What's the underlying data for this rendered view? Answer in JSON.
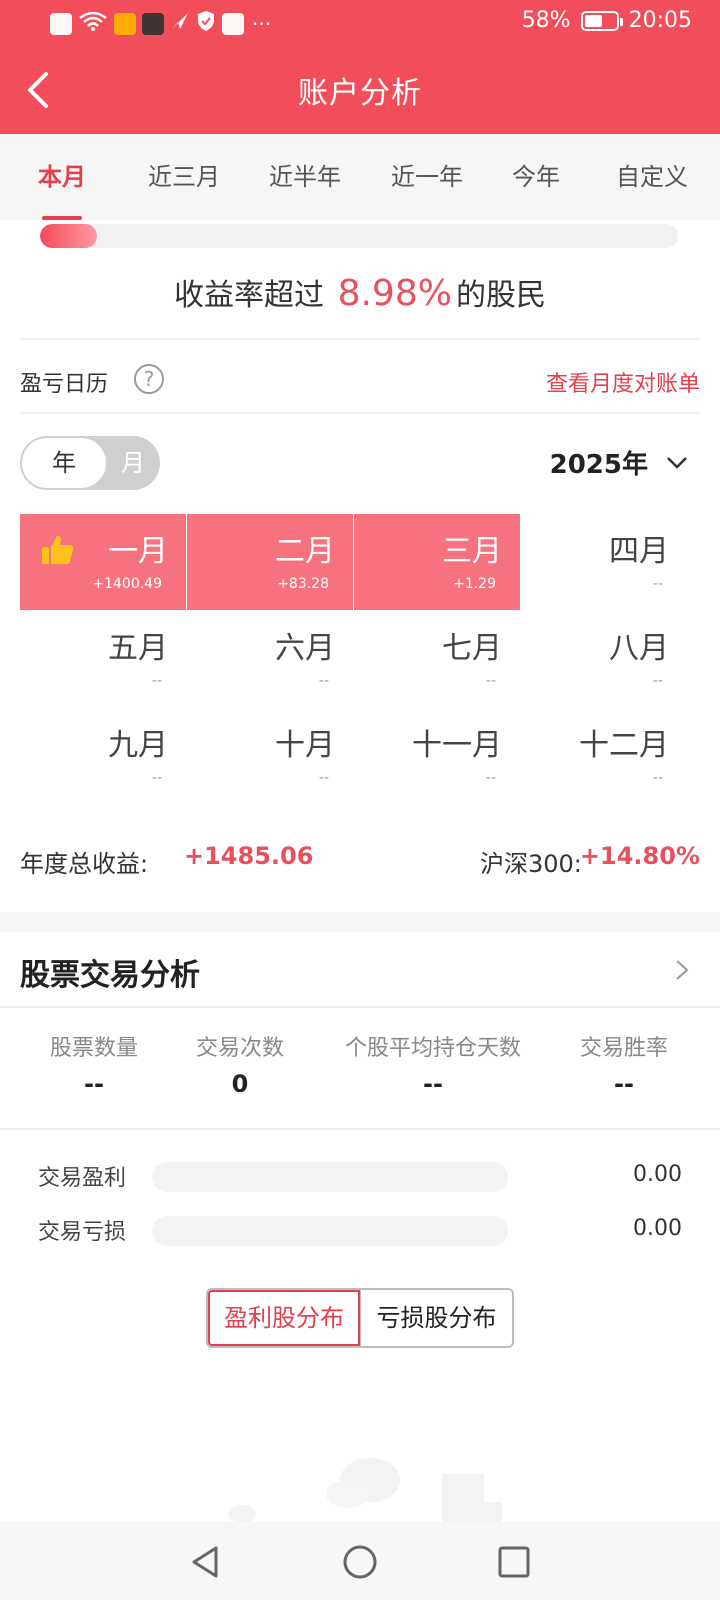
{
  "status_bar": {
    "battery": "58%",
    "time": "20:05",
    "battery_level": 0.58,
    "icons": [
      "alert-icon",
      "wifi-icon",
      "app-icon",
      "app-icon",
      "send-icon",
      "shield-icon",
      "book-icon"
    ]
  },
  "header": {
    "title": "账户分析"
  },
  "tabs": [
    {
      "label": "本月",
      "active": true
    },
    {
      "label": "近三月"
    },
    {
      "label": "近半年"
    },
    {
      "label": "近一年"
    },
    {
      "label": "今年"
    },
    {
      "label": "自定义"
    }
  ],
  "beat": {
    "prefix": "收益率超过",
    "percent": "8.98%",
    "suffix": "的股民",
    "progress": 0.0898
  },
  "calendar": {
    "title": "盈亏日历",
    "help": "?",
    "bill_link": "查看月度对账单",
    "toggle": {
      "year": "年",
      "month": "月"
    },
    "year_label": "2025年",
    "months": [
      {
        "name": "一月",
        "value": "+1400.49",
        "positive": true,
        "best": true
      },
      {
        "name": "二月",
        "value": "+83.28",
        "positive": true
      },
      {
        "name": "三月",
        "value": "+1.29",
        "positive": true
      },
      {
        "name": "四月",
        "value": "--"
      },
      {
        "name": "五月",
        "value": "--"
      },
      {
        "name": "六月",
        "value": "--"
      },
      {
        "name": "七月",
        "value": "--"
      },
      {
        "name": "八月",
        "value": "--"
      },
      {
        "name": "九月",
        "value": "--"
      },
      {
        "name": "十月",
        "value": "--"
      },
      {
        "name": "十一月",
        "value": "--"
      },
      {
        "name": "十二月",
        "value": "--"
      }
    ],
    "total_label": "年度总收益:",
    "total_value": "+1485.06",
    "index_label": "沪深300:",
    "index_value": "+14.80%"
  },
  "analysis": {
    "title": "股票交易分析",
    "stats": [
      {
        "label": "股票数量",
        "value": "--"
      },
      {
        "label": "交易次数",
        "value": "0"
      },
      {
        "label": "个股平均持仓天数",
        "value": "--"
      },
      {
        "label": "交易胜率",
        "value": "--"
      }
    ],
    "profit_label": "交易盈利",
    "profit_value": "0.00",
    "loss_label": "交易亏损",
    "loss_value": "0.00",
    "dist_profit": "盈利股分布",
    "dist_loss": "亏损股分布"
  },
  "colors": {
    "brand": "#f24d5b",
    "positive": "#e85060",
    "cell": "#f5727e"
  }
}
